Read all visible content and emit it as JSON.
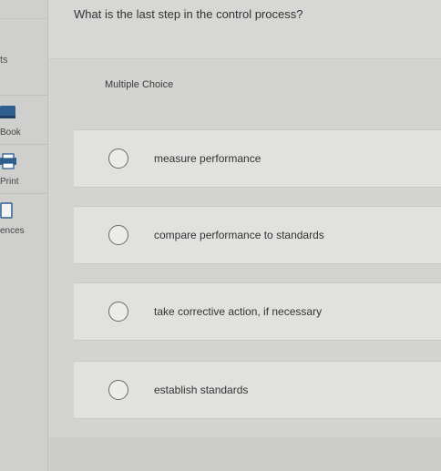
{
  "question": {
    "text": "What is the last step in the control process?",
    "type_label": "Multiple Choice"
  },
  "sidebar": {
    "stub_label": "ts",
    "items": [
      {
        "label": "Book",
        "icon": "book-icon"
      },
      {
        "label": "Print",
        "icon": "print-icon"
      },
      {
        "label": "ences",
        "icon": "references-icon"
      }
    ]
  },
  "choices": [
    {
      "label": "measure performance",
      "selected": false
    },
    {
      "label": "compare performance to standards",
      "selected": false
    },
    {
      "label": "take corrective action, if necessary",
      "selected": false
    },
    {
      "label": "establish standards",
      "selected": false
    }
  ],
  "colors": {
    "accent": "#2f5f8f",
    "page_bg": "#d3d3d1",
    "card_bg": "#e1e1df"
  }
}
